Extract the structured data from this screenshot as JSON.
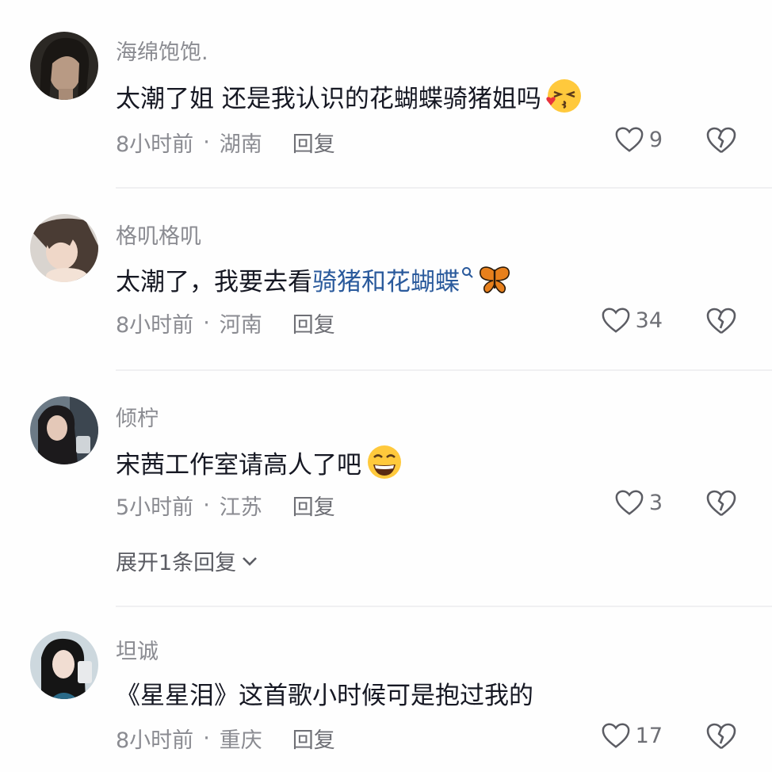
{
  "comments": [
    {
      "username": "海绵饱饱.",
      "text": "太潮了姐 还是我认识的花蝴蝶骑猪姐吗",
      "emoji": "kissing-face-emoji",
      "time": "8小时前",
      "location": "湖南",
      "reply_label": "回复",
      "likes": "9"
    },
    {
      "username": "格叽格叽",
      "text_prefix": "太潮了，我要去看",
      "text_link": "骑猪和花蝴蝶",
      "emoji": "butterfly-emoji",
      "time": "8小时前",
      "location": "河南",
      "reply_label": "回复",
      "likes": "34"
    },
    {
      "username": "倾柠",
      "text": "宋茜工作室请高人了吧",
      "emoji": "grinning-face-emoji",
      "time": "5小时前",
      "location": "江苏",
      "reply_label": "回复",
      "likes": "3",
      "expand_label": "展开1条回复"
    },
    {
      "username": "坦诚",
      "text": "《星星泪》这首歌小时候可是抱过我的",
      "time": "8小时前",
      "location": "重庆",
      "reply_label": "回复",
      "likes": "17"
    }
  ],
  "meta_separator": "·",
  "colors": {
    "text": "#161823",
    "secondary": "#8a8b91",
    "link": "#2a5a9c",
    "divider": "#f0f0f2"
  }
}
